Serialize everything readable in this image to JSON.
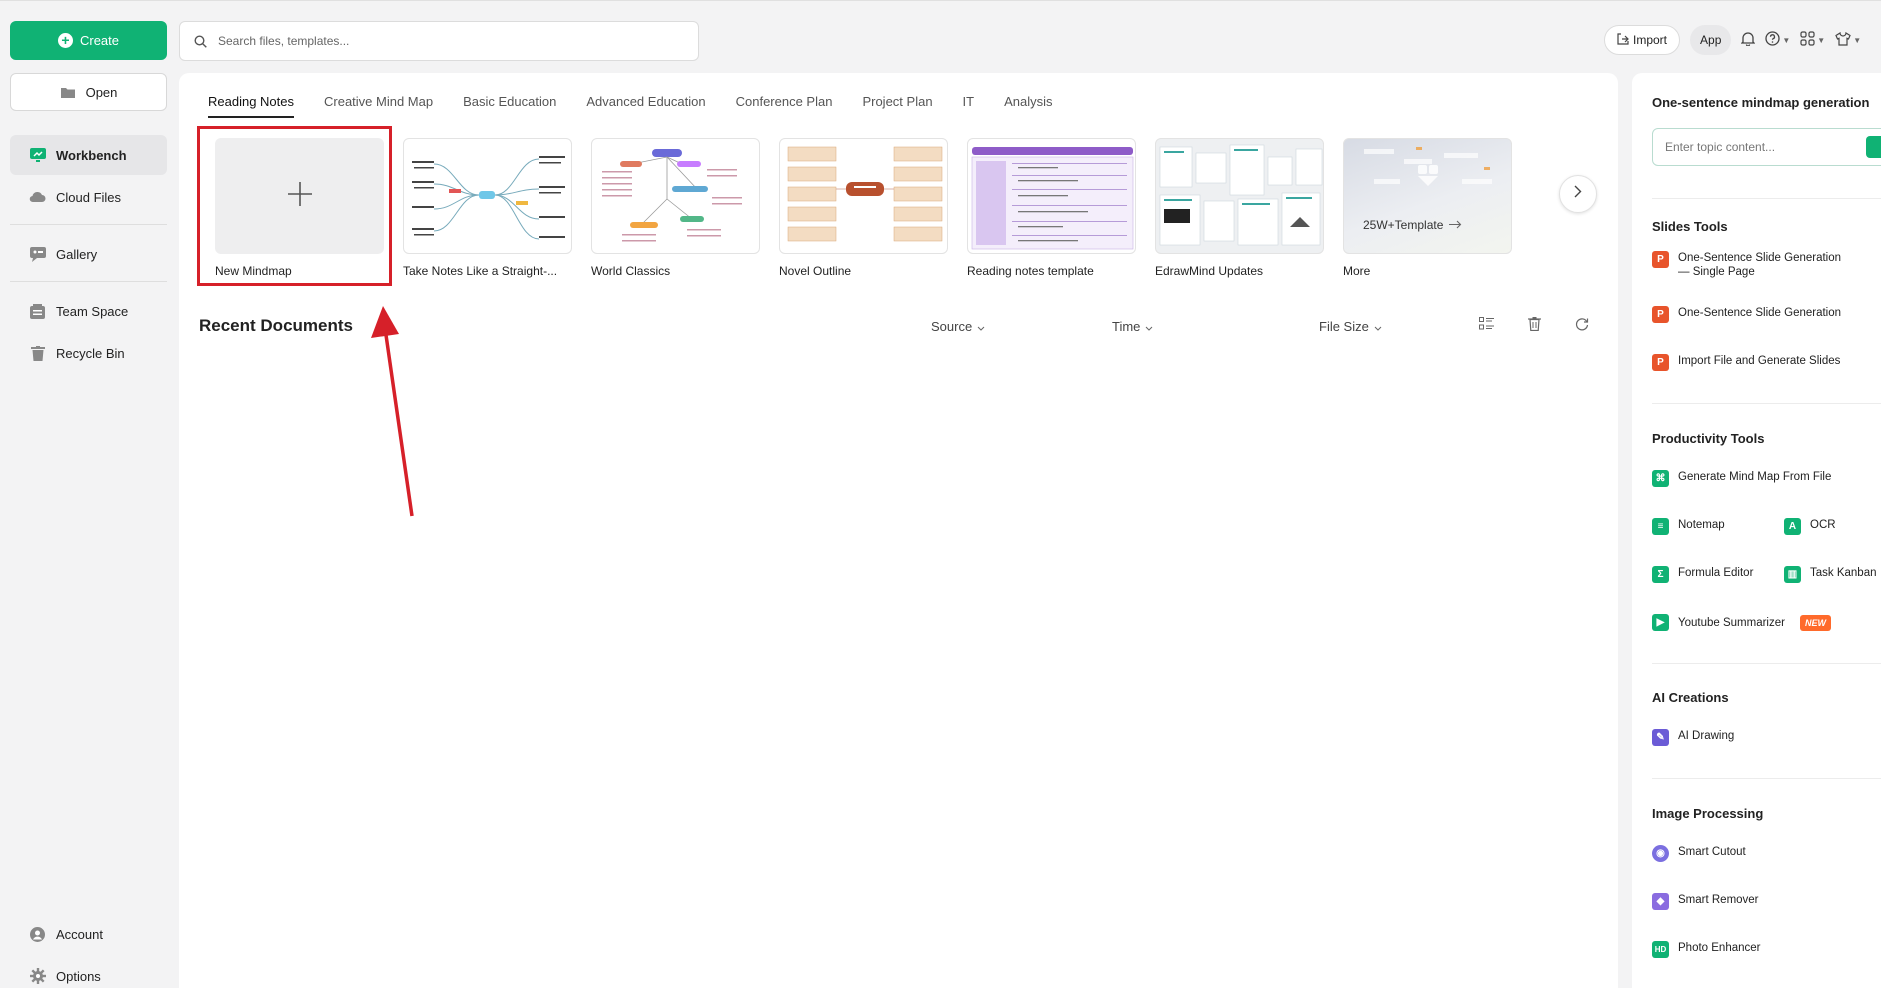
{
  "sidebar": {
    "create_label": "Create",
    "open_label": "Open",
    "items": [
      {
        "label": "Workbench"
      },
      {
        "label": "Cloud Files"
      },
      {
        "label": "Gallery"
      },
      {
        "label": "Team Space"
      },
      {
        "label": "Recycle Bin"
      }
    ],
    "bottom": [
      {
        "label": "Account"
      },
      {
        "label": "Options"
      }
    ]
  },
  "search": {
    "placeholder": "Search files, templates..."
  },
  "topbar": {
    "import_label": "Import",
    "app_label": "App"
  },
  "tabs": [
    "Reading Notes",
    "Creative Mind Map",
    "Basic Education",
    "Advanced Education",
    "Conference Plan",
    "Project Plan",
    "IT",
    "Analysis"
  ],
  "templates": [
    {
      "name": "New Mindmap"
    },
    {
      "name": "Take Notes Like a Straight-..."
    },
    {
      "name": "World Classics"
    },
    {
      "name": "Novel Outline"
    },
    {
      "name": "Reading notes template"
    },
    {
      "name": "EdrawMind Updates"
    },
    {
      "name": "More",
      "overlay": "25W+Template"
    }
  ],
  "recent": {
    "title": "Recent Documents",
    "source_label": "Source",
    "time_label": "Time",
    "size_label": "File Size"
  },
  "right_panel": {
    "generator_title": "One-sentence mindmap generation",
    "generator_placeholder": "Enter topic content...",
    "slides_title": "Slides Tools",
    "slides": [
      {
        "label": "One-Sentence Slide Generation — Single Page"
      },
      {
        "label": "One-Sentence Slide Generation"
      },
      {
        "label": "Import File and Generate Slides"
      }
    ],
    "productivity_title": "Productivity Tools",
    "productivity": [
      {
        "label": "Generate Mind Map From File"
      },
      {
        "label": "Notemap"
      },
      {
        "label": "OCR"
      },
      {
        "label": "Formula Editor"
      },
      {
        "label": "Task Kanban"
      },
      {
        "label": "Youtube Summarizer",
        "badge": "NEW"
      }
    ],
    "ai_title": "AI Creations",
    "ai": [
      {
        "label": "AI Drawing"
      }
    ],
    "image_title": "Image Processing",
    "image": [
      {
        "label": "Smart Cutout"
      },
      {
        "label": "Smart Remover"
      },
      {
        "label": "Photo Enhancer"
      }
    ]
  },
  "colors": {
    "accent": "#10b274",
    "highlight": "#d62029",
    "slide_icon": "#e8542b"
  }
}
